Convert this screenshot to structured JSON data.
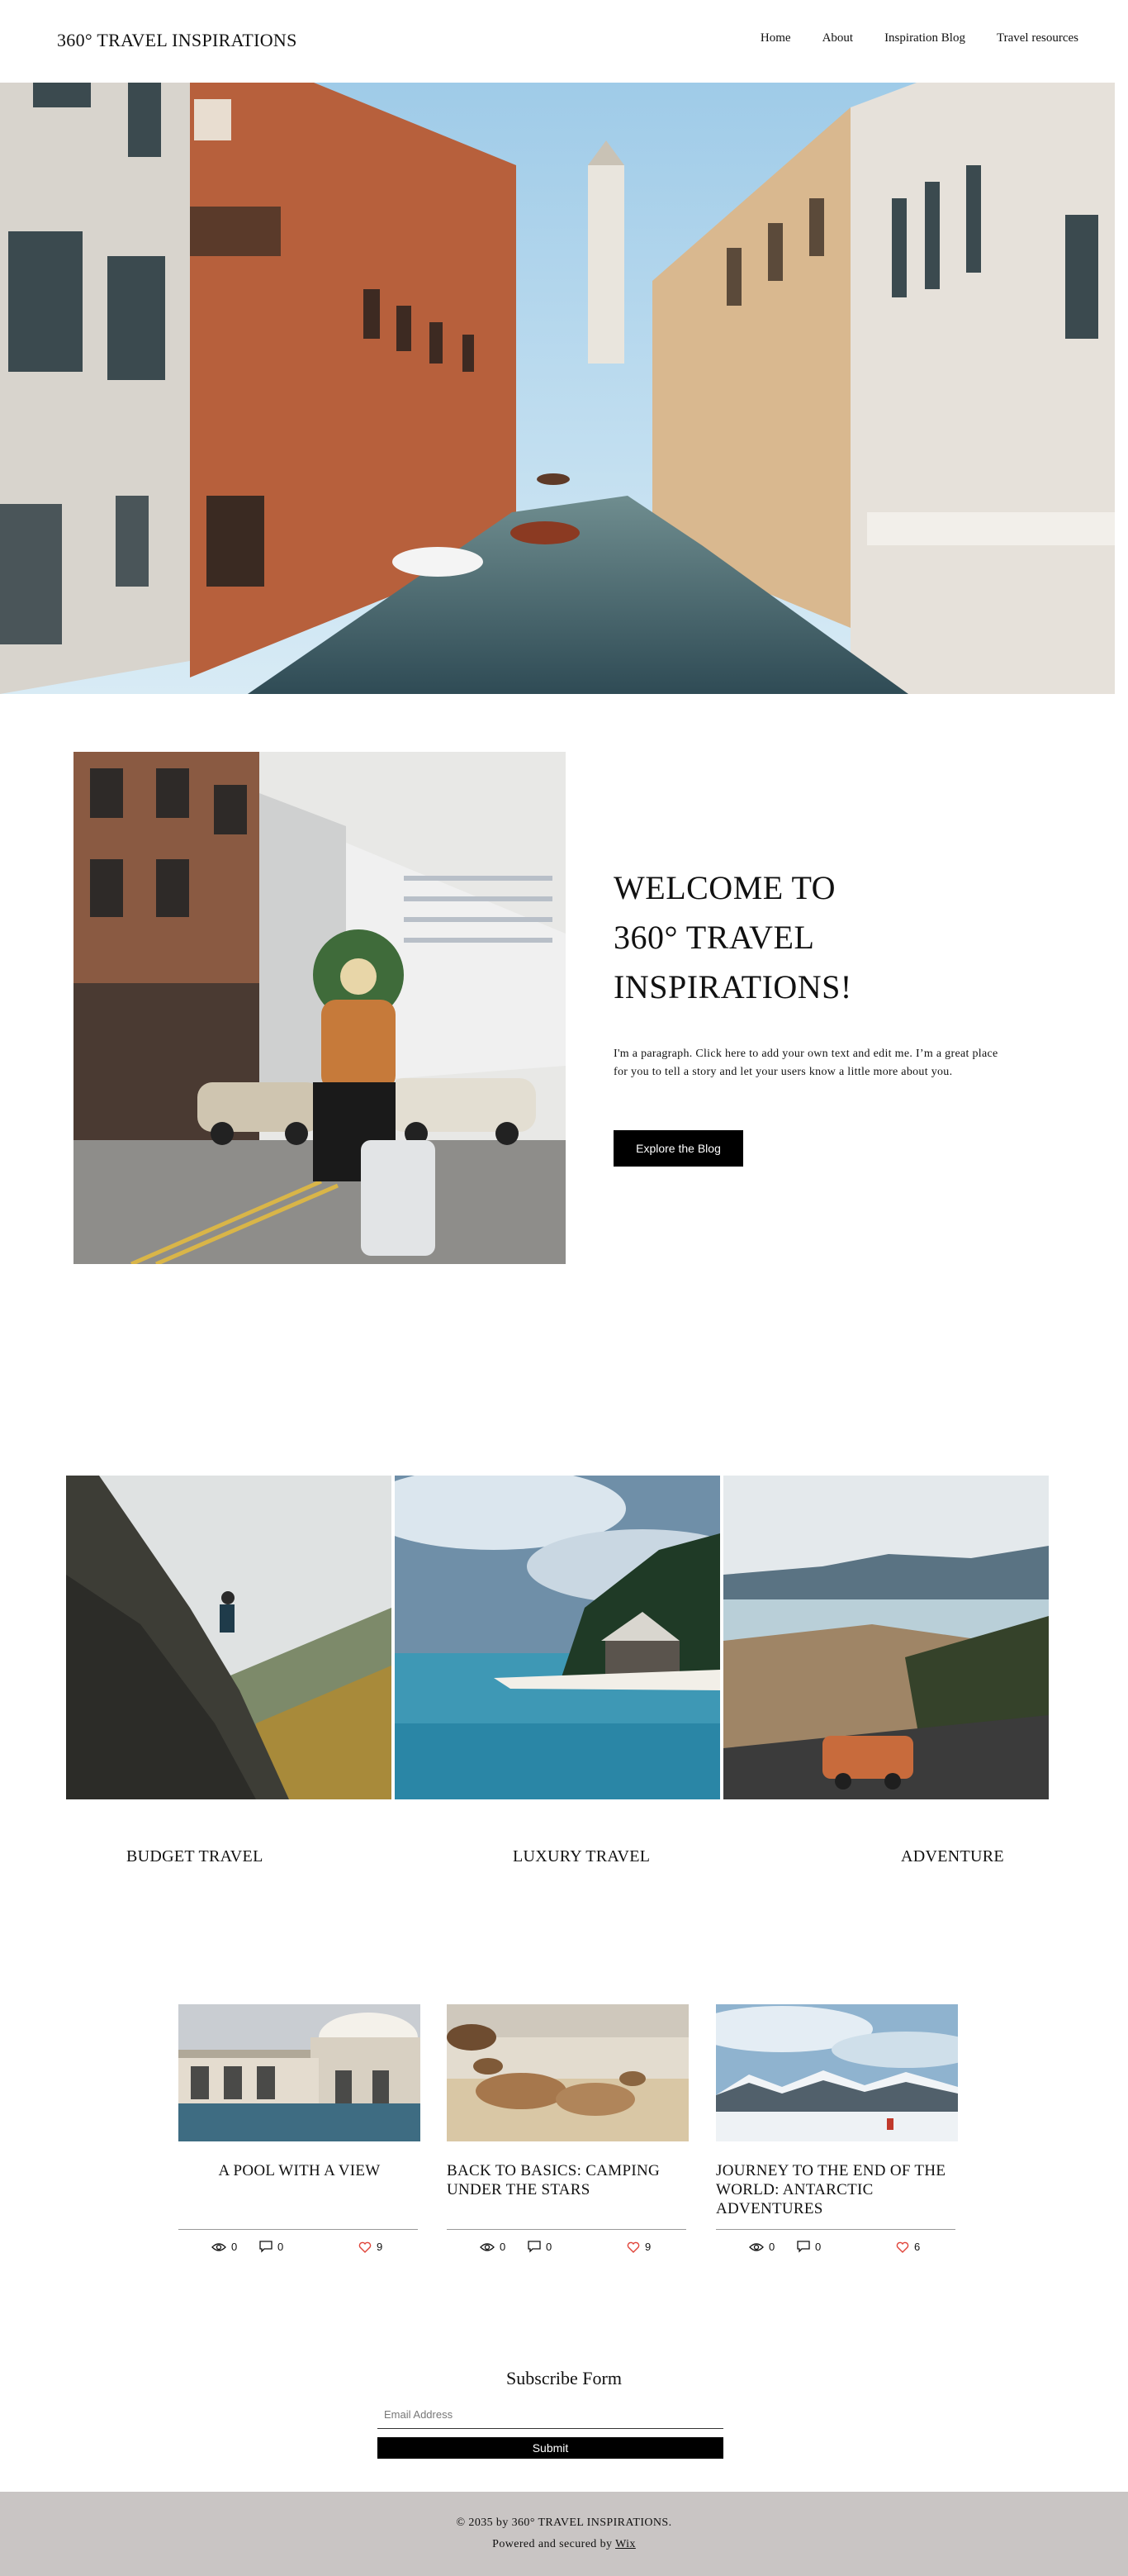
{
  "header": {
    "logo": "360° TRAVEL INSPIRATIONS",
    "nav": [
      "Home",
      "About",
      "Inspiration Blog",
      "Travel resources"
    ]
  },
  "welcome": {
    "title_lines": [
      "WELCOME TO",
      "360° TRAVEL",
      "INSPIRATIONS!"
    ],
    "paragraph": "I'm a paragraph. Click here to add your own text and edit me. I’m a great place for you to tell a story and let your users know a little more about you.",
    "button": "Explore the Blog"
  },
  "categories": [
    {
      "label": "BUDGET TRAVEL"
    },
    {
      "label": "LUXURY TRAVEL"
    },
    {
      "label": "ADVENTURE"
    }
  ],
  "posts": [
    {
      "title": "A POOL WITH A VIEW",
      "views": "0",
      "comments": "0",
      "likes": "9"
    },
    {
      "title": "BACK TO BASICS: CAMPING UNDER THE STARS",
      "views": "0",
      "comments": "0",
      "likes": "9"
    },
    {
      "title": "JOURNEY TO THE END OF THE WORLD: ANTARCTIC ADVENTURES",
      "views": "0",
      "comments": "0",
      "likes": "6"
    }
  ],
  "subscribe": {
    "title": "Subscribe Form",
    "placeholder": "Email Address",
    "button": "Submit"
  },
  "footer": {
    "copyright": "© 2035 by 360° TRAVEL INSPIRATIONS.",
    "powered_prefix": "Powered and secured by",
    "powered_link": "Wix"
  },
  "colors": {
    "accent": "#000000",
    "footer_bg": "#c9c5c4",
    "heart": "#e0443a"
  }
}
